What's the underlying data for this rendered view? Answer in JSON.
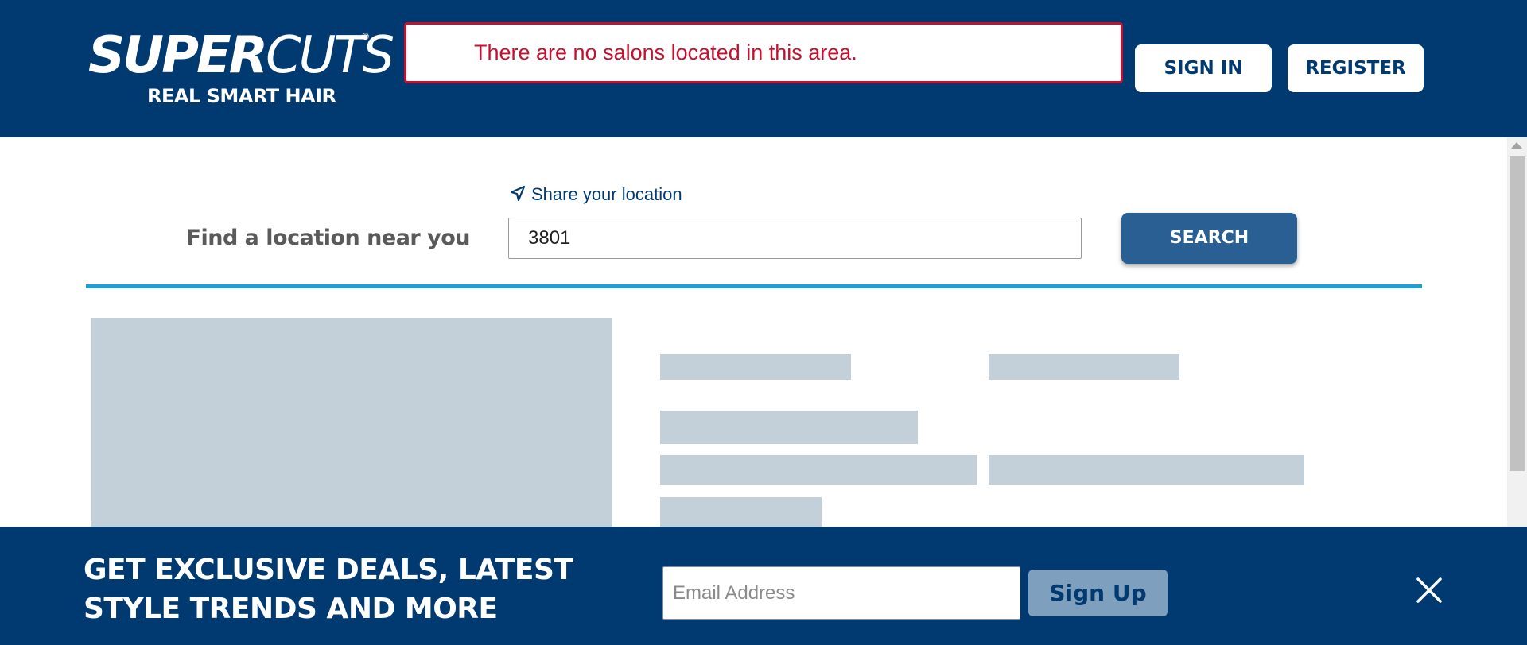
{
  "header": {
    "logo": {
      "brand_bold": "SUPER",
      "brand_light": "CUTS",
      "registered_mark": "®",
      "tagline": "REAL SMART HAIR"
    },
    "alert_message": "There are no salons located in this area.",
    "sign_in_label": "SIGN IN",
    "register_label": "REGISTER"
  },
  "search": {
    "share_location_label": "Share your location",
    "share_location_icon": "location-arrow-icon",
    "find_label": "Find a location near you",
    "input_value": "3801",
    "button_label": "SEARCH"
  },
  "promo": {
    "headline": "GET EXCLUSIVE DEALS, LATEST STYLE TRENDS AND MORE",
    "email_placeholder": "Email Address",
    "signup_label": "Sign Up",
    "close_icon": "close-icon"
  },
  "colors": {
    "brand_navy": "#003a70",
    "alert_red": "#c8102e",
    "search_button": "#2a5f93",
    "divider_blue": "#1fa0d1",
    "skeleton_gray": "#c3d0d9",
    "signup_button": "#7f9fbf"
  }
}
